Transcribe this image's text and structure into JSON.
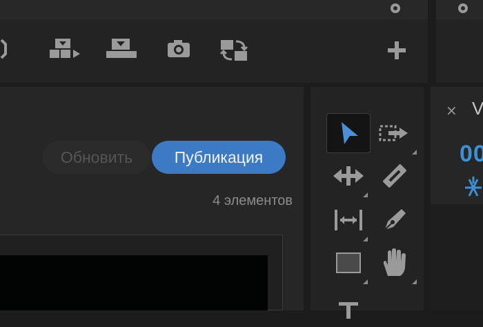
{
  "top_bar": {
    "left_button_icon": "panel-options-circle-icon",
    "right_button_icon": "panel-options-circle-icon"
  },
  "monitor_toolbar": {
    "icons": [
      "insert-partial-icon",
      "overwrite-icon",
      "lift-icon",
      "export-frame-icon",
      "swap-compare-icon",
      "add-button-icon"
    ]
  },
  "project_panel": {
    "refresh_label": "Обновить",
    "publish_label": "Публикация",
    "items_count": "4 элементов"
  },
  "tools_panel": {
    "tools": [
      {
        "name": "selection-tool",
        "selected": true
      },
      {
        "name": "track-select-forward-tool",
        "selected": false
      },
      {
        "name": "ripple-edit-tool",
        "selected": false
      },
      {
        "name": "razor-tool",
        "selected": false
      },
      {
        "name": "slip-tool",
        "selected": false
      },
      {
        "name": "pen-tool",
        "selected": false
      },
      {
        "name": "rectangle-tool",
        "selected": false
      },
      {
        "name": "hand-tool",
        "selected": false
      },
      {
        "name": "type-tool",
        "selected": false
      }
    ]
  },
  "right_panel": {
    "close_label": "×",
    "tab_label": "V",
    "timecode": "00"
  },
  "colors": {
    "accent": "#3d7ac4",
    "timecode": "#3d8fd6",
    "background": "#1c1c1c"
  }
}
